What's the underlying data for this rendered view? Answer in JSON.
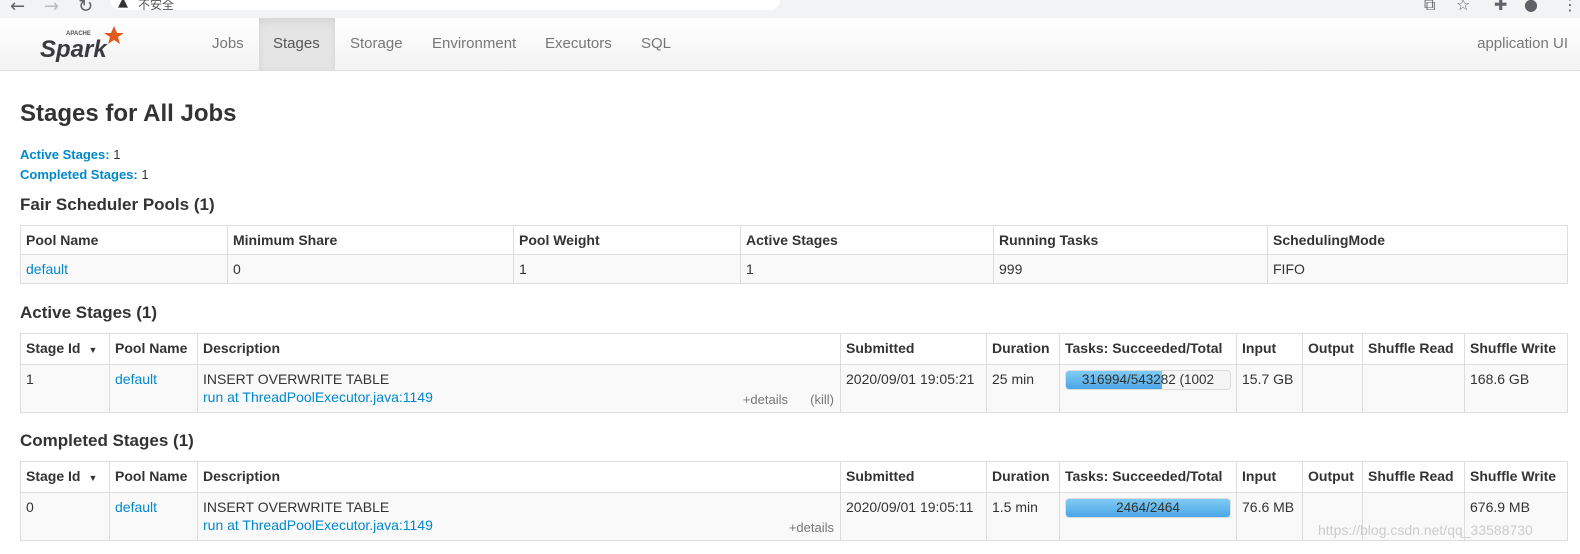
{
  "browser": {
    "warning_text": "不安全",
    "icons": [
      "back-arrow-icon",
      "forward-arrow-icon",
      "reload-icon",
      "translate-icon",
      "star-icon",
      "extensions-icon",
      "profile-icon",
      "menu-icon"
    ]
  },
  "navbar": {
    "logo_small": "APACHE",
    "logo_text": "Spark",
    "tabs": [
      {
        "label": "Jobs",
        "active": false
      },
      {
        "label": "Stages",
        "active": true
      },
      {
        "label": "Storage",
        "active": false
      },
      {
        "label": "Environment",
        "active": false
      },
      {
        "label": "Executors",
        "active": false
      },
      {
        "label": "SQL",
        "active": false
      }
    ],
    "app_label": "application UI"
  },
  "page": {
    "title": "Stages for All Jobs",
    "summary": [
      {
        "label": "Active Stages:",
        "value": "1"
      },
      {
        "label": "Completed Stages:",
        "value": "1"
      }
    ]
  },
  "pools": {
    "heading": "Fair Scheduler Pools (1)",
    "columns": [
      "Pool Name",
      "Minimum Share",
      "Pool Weight",
      "Active Stages",
      "Running Tasks",
      "SchedulingMode"
    ],
    "rows": [
      [
        "default",
        "0",
        "1",
        "1",
        "999",
        "FIFO"
      ]
    ]
  },
  "active_stages": {
    "heading": "Active Stages (1)",
    "columns": [
      "Stage Id",
      "Pool Name",
      "Description",
      "Submitted",
      "Duration",
      "Tasks: Succeeded/Total",
      "Input",
      "Output",
      "Shuffle Read",
      "Shuffle Write"
    ],
    "rows": [
      {
        "stage_id": "1",
        "pool": "default",
        "desc_line1": "INSERT OVERWRITE TABLE",
        "desc_line2": "run at ThreadPoolExecutor.java:1149",
        "details": "+details",
        "kill": "(kill)",
        "submitted": "2020/09/01 19:05:21",
        "duration": "25 min",
        "tasks_text": "316994/543282 (1002",
        "tasks_fraction": 0.583,
        "input": "15.7 GB",
        "output": "",
        "shuffle_read": "",
        "shuffle_write": "168.6 GB"
      }
    ]
  },
  "completed_stages": {
    "heading": "Completed Stages (1)",
    "columns": [
      "Stage Id",
      "Pool Name",
      "Description",
      "Submitted",
      "Duration",
      "Tasks: Succeeded/Total",
      "Input",
      "Output",
      "Shuffle Read",
      "Shuffle Write"
    ],
    "rows": [
      {
        "stage_id": "0",
        "pool": "default",
        "desc_line1": "INSERT OVERWRITE TABLE",
        "desc_line2": "run at ThreadPoolExecutor.java:1149",
        "details": "+details",
        "submitted": "2020/09/01 19:05:11",
        "duration": "1.5 min",
        "tasks_text": "2464/2464",
        "tasks_fraction": 1.0,
        "input": "76.6 MB",
        "output": "",
        "shuffle_read": "",
        "shuffle_write": "676.9 MB"
      }
    ]
  },
  "watermark": "https://blog.csdn.net/qq_33588730"
}
